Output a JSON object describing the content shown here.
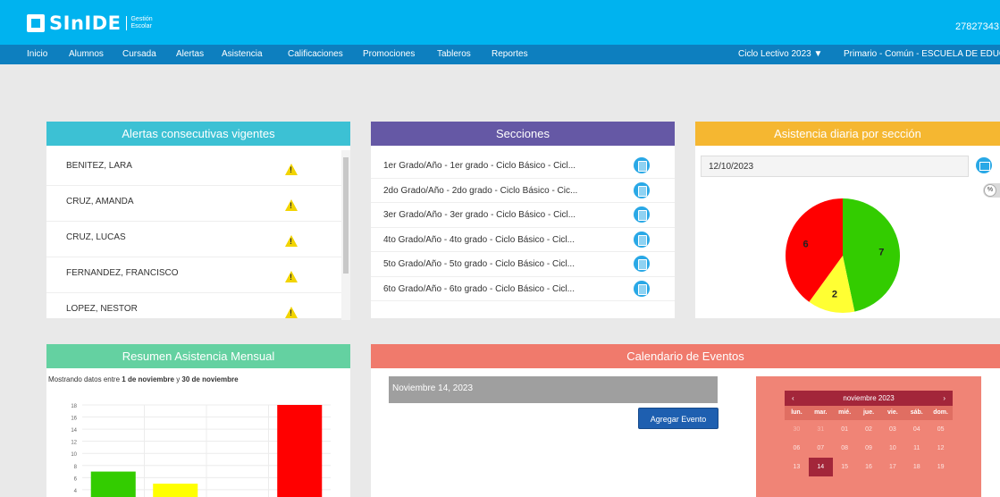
{
  "header": {
    "logo_text": "SInIDE",
    "logo_sub1": "Gestión",
    "logo_sub2": "Escolar",
    "user_id": "27827343"
  },
  "nav": {
    "items": [
      "Inicio",
      "Alumnos",
      "Cursada",
      "Alertas",
      "Asistencia",
      "Calificaciones",
      "Promociones",
      "Tableros",
      "Reportes"
    ],
    "ciclo": "Ciclo Lectivo 2023",
    "escuela": "Primario - Común - ESCUELA DE EDUC"
  },
  "alertas": {
    "title": "Alertas consecutivas vigentes",
    "rows": [
      "BENITEZ, LARA",
      "CRUZ, AMANDA",
      "CRUZ, LUCAS",
      "FERNANDEZ, FRANCISCO",
      "LOPEZ, NESTOR"
    ]
  },
  "secciones": {
    "title": "Secciones",
    "rows": [
      "1er Grado/Año - 1er grado - Ciclo Básico - Cicl...",
      "2do Grado/Año - 2do grado - Ciclo Básico - Cic...",
      "3er Grado/Año - 3er grado - Ciclo Básico - Cicl...",
      "4to Grado/Año - 4to grado - Ciclo Básico - Cicl...",
      "5to Grado/Año - 5to grado - Ciclo Básico - Cicl...",
      "6to Grado/Año - 6to grado - Ciclo Básico - Cicl..."
    ]
  },
  "asistencia": {
    "title": "Asistencia diaria por sección",
    "date": "12/10/2023",
    "toggle_label": "%"
  },
  "resumen": {
    "title": "Resumen Asistencia Mensual",
    "caption_pre": "Mostrando datos entre ",
    "caption_from": "1 de noviembre",
    "caption_mid": " y ",
    "caption_to": "30 de noviembre"
  },
  "calendario": {
    "title": "Calendario de Eventos",
    "selected_date": "Noviembre 14, 2023",
    "add_button": "Agregar Evento",
    "month": "noviembre 2023",
    "prev": "‹",
    "next": "›",
    "dows": [
      "lun.",
      "mar.",
      "mié.",
      "jue.",
      "vie.",
      "sáb.",
      "dom."
    ],
    "weeks": [
      [
        "30",
        "31",
        "01",
        "02",
        "03",
        "04",
        "05"
      ],
      [
        "06",
        "07",
        "08",
        "09",
        "10",
        "11",
        "12"
      ],
      [
        "13",
        "14",
        "15",
        "16",
        "17",
        "18",
        "19"
      ]
    ]
  },
  "colors": {
    "topbar": "#00b3ef",
    "navbar": "#0d7fbf",
    "alertas_head": "#3cc1d4",
    "secciones_head": "#6558a5",
    "asistencia_head": "#f5b731",
    "resumen_head": "#64d1a1",
    "calendario_head": "#f07a6c"
  },
  "chart_data": [
    {
      "type": "pie",
      "labels": [
        "",
        "",
        ""
      ],
      "values": [
        7,
        2,
        6
      ],
      "colors": [
        "#33cc00",
        "#ffff33",
        "#ff0000"
      ]
    },
    {
      "type": "bar",
      "categories": [
        "",
        "",
        "",
        ""
      ],
      "values": [
        7,
        5,
        0,
        18
      ],
      "colors": [
        "#33cc00",
        "#ffff00",
        "#999999",
        "#ff0000"
      ],
      "ylim": [
        0,
        18
      ],
      "yticks": [
        4,
        6,
        8,
        10,
        12,
        14,
        16,
        18
      ]
    }
  ]
}
